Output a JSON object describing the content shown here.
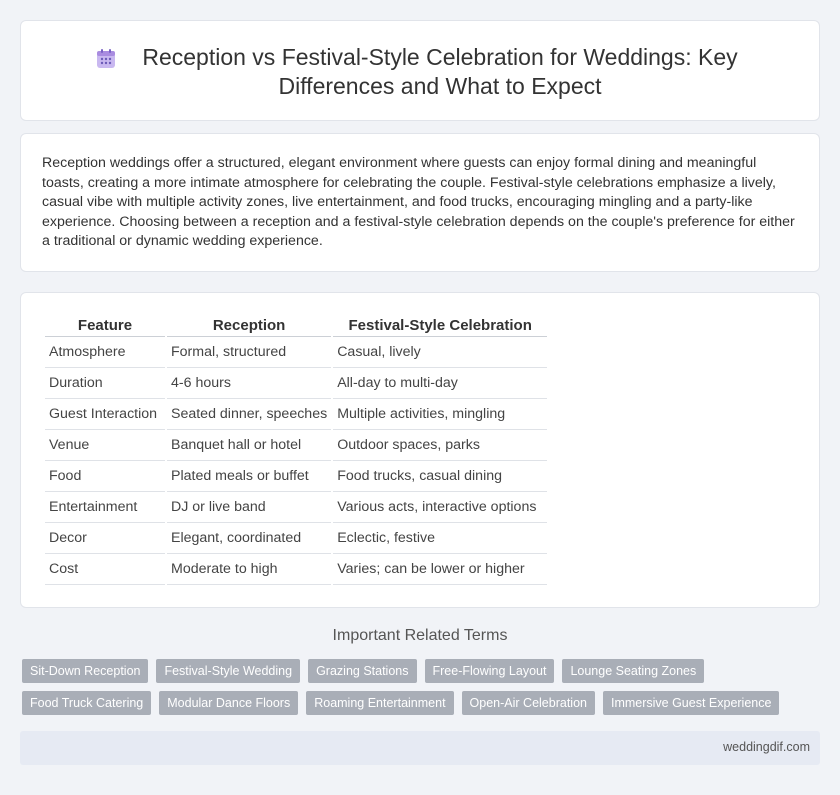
{
  "header": {
    "icon": "calendar-icon",
    "title": "Reception vs Festival-Style Celebration for Weddings: Key Differences and What to Expect"
  },
  "intro": {
    "text": "Reception weddings offer a structured, elegant environment where guests can enjoy formal dining and meaningful toasts, creating a more intimate atmosphere for celebrating the couple. Festival-style celebrations emphasize a lively, casual vibe with multiple activity zones, live entertainment, and food trucks, encouraging mingling and a party-like experience. Choosing between a reception and a festival-style celebration depends on the couple's preference for either a traditional or dynamic wedding experience."
  },
  "table": {
    "headers": [
      "Feature",
      "Reception",
      "Festival-Style Celebration"
    ],
    "rows": [
      [
        "Atmosphere",
        "Formal, structured",
        "Casual, lively"
      ],
      [
        "Duration",
        "4-6 hours",
        "All-day to multi-day"
      ],
      [
        "Guest Interaction",
        "Seated dinner, speeches",
        "Multiple activities, mingling"
      ],
      [
        "Venue",
        "Banquet hall or hotel",
        "Outdoor spaces, parks"
      ],
      [
        "Food",
        "Plated meals or buffet",
        "Food trucks, casual dining"
      ],
      [
        "Entertainment",
        "DJ or live band",
        "Various acts, interactive options"
      ],
      [
        "Decor",
        "Elegant, coordinated",
        "Eclectic, festive"
      ],
      [
        "Cost",
        "Moderate to high",
        "Varies; can be lower or higher"
      ]
    ]
  },
  "related": {
    "title": "Important Related Terms",
    "terms": [
      "Sit-Down Reception",
      "Festival-Style Wedding",
      "Grazing Stations",
      "Free-Flowing Layout",
      "Lounge Seating Zones",
      "Food Truck Catering",
      "Modular Dance Floors",
      "Roaming Entertainment",
      "Open-Air Celebration",
      "Immersive Guest Experience"
    ]
  },
  "footer": {
    "site": "weddingdif.com"
  },
  "colors": {
    "background": "#f1f3f7",
    "tag": "#a9aeb7",
    "footer": "#e6eaf3",
    "icon": "#b9a6e8"
  }
}
